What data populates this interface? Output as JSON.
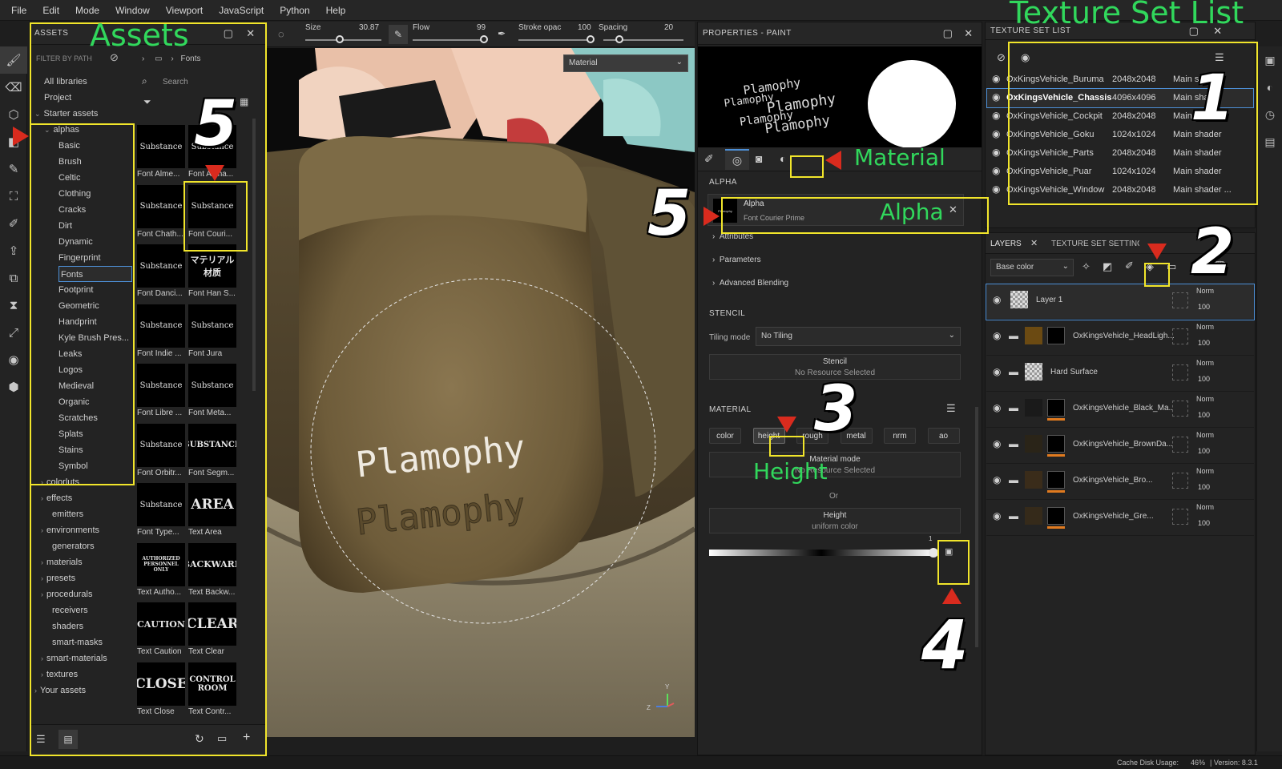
{
  "menu": [
    "File",
    "Edit",
    "Mode",
    "Window",
    "Viewport",
    "JavaScript",
    "Python",
    "Help"
  ],
  "assets": {
    "title": "ASSETS",
    "filter_placeholder": "FILTER BY PATH",
    "breadcrumb": "Fonts",
    "search_placeholder": "Search",
    "tree": {
      "all_libraries": "All libraries",
      "project": "Project",
      "starter_assets": "Starter assets",
      "alphas": "alphas",
      "alpha_children": [
        "Basic",
        "Brush",
        "Celtic",
        "Clothing",
        "Cracks",
        "Dirt",
        "Dynamic",
        "Fingerprint",
        "Fonts",
        "Footprint",
        "Geometric",
        "Handprint",
        "Kyle Brush Pres...",
        "Leaks",
        "Logos",
        "Medieval",
        "Organic",
        "Scratches",
        "Splats",
        "Stains",
        "Symbol"
      ],
      "others": [
        {
          "label": "colorluts",
          "arrow": true
        },
        {
          "label": "effects",
          "arrow": true
        },
        {
          "label": "emitters",
          "arrow": false
        },
        {
          "label": "environments",
          "arrow": true
        },
        {
          "label": "generators",
          "arrow": false
        },
        {
          "label": "materials",
          "arrow": true
        },
        {
          "label": "presets",
          "arrow": true
        },
        {
          "label": "procedurals",
          "arrow": true
        },
        {
          "label": "receivers",
          "arrow": false
        },
        {
          "label": "shaders",
          "arrow": false
        },
        {
          "label": "smart-masks",
          "arrow": false
        },
        {
          "label": "smart-materials",
          "arrow": true
        },
        {
          "label": "textures",
          "arrow": true
        }
      ],
      "your_assets": "Your assets"
    },
    "thumbs": [
      {
        "img": "Substance",
        "label": "Font Alme..."
      },
      {
        "img": "Substance",
        "label": "Font Alpha..."
      },
      {
        "img": "Substance",
        "label": "Font Chath..."
      },
      {
        "img": "Substance",
        "label": "Font Couri..."
      },
      {
        "img": "Substance",
        "label": "Font Danci..."
      },
      {
        "img": "マテリアル 材质",
        "label": "Font Han S..."
      },
      {
        "img": "Substance",
        "label": "Font Indie ..."
      },
      {
        "img": "Substance",
        "label": "Font Jura"
      },
      {
        "img": "Substance",
        "label": "Font Libre ..."
      },
      {
        "img": "Substance",
        "label": "Font Meta..."
      },
      {
        "img": "Substance",
        "label": "Font Orbitr..."
      },
      {
        "img": "SUBSTANCE",
        "label": "Font Segm..."
      },
      {
        "img": "Substance",
        "label": "Font Type..."
      },
      {
        "img": "AREA",
        "label": "Text Area"
      },
      {
        "img": "AUTHORIZED PERSONNEL ONLY",
        "label": "Text Autho..."
      },
      {
        "img": "BACKWARD",
        "label": "Text Backw..."
      },
      {
        "img": "CAUTION",
        "label": "Text Caution"
      },
      {
        "img": "CLEAR",
        "label": "Text Clear"
      },
      {
        "img": "CLOSE",
        "label": "Text Close"
      },
      {
        "img": "CONTROL ROOM",
        "label": "Text Contr..."
      }
    ]
  },
  "brushbar": {
    "size_label": "Size",
    "size_value": "30.87",
    "flow_label": "Flow",
    "flow_value": "99",
    "stroke_label": "Stroke opac",
    "stroke_value": "100",
    "spacing_label": "Spacing",
    "spacing_value": "20",
    "size_fraction": 0.45,
    "flow_fraction": 0.99,
    "stroke_fraction": 1.0,
    "spacing_fraction": 0.2
  },
  "viewport": {
    "material_dropdown": "Material",
    "decal_text": "Plamophy",
    "axis_y": "Y",
    "axis_z": "Z"
  },
  "properties": {
    "title": "PROPERTIES - PAINT",
    "alpha_section": "ALPHA",
    "alpha_name": "Alpha",
    "alpha_sub": "Font Courier Prime",
    "alpha_thumb_text": "Plamophy",
    "attributes": "Attributes",
    "parameters": "Parameters",
    "advanced_blending": "Advanced Blending",
    "stencil_section": "STENCIL",
    "tiling_mode_label": "Tiling mode",
    "tiling_mode_value": "No Tiling",
    "stencil_title": "Stencil",
    "stencil_sub": "No Resource Selected",
    "material_section": "MATERIAL",
    "channels": [
      "color",
      "height",
      "rough",
      "metal",
      "nrm",
      "ao"
    ],
    "material_mode_title": "Material mode",
    "material_mode_sub": "No Resource Selected",
    "or_label": "Or",
    "height_title": "Height",
    "height_sub": "uniform color",
    "height_value": "1"
  },
  "texture_set_list": {
    "title": "TEXTURE SET LIST",
    "rows": [
      {
        "name": "OxKingsVehicle_Buruma",
        "res": "2048x2048",
        "shader": "Main shader"
      },
      {
        "name": "OxKingsVehicle_Chassis",
        "res": "4096x4096",
        "shader": "Main shader"
      },
      {
        "name": "OxKingsVehicle_Cockpit",
        "res": "2048x2048",
        "shader": "Main shader"
      },
      {
        "name": "OxKingsVehicle_Goku",
        "res": "1024x1024",
        "shader": "Main shader"
      },
      {
        "name": "OxKingsVehicle_Parts",
        "res": "2048x2048",
        "shader": "Main shader"
      },
      {
        "name": "OxKingsVehicle_Puar",
        "res": "1024x1024",
        "shader": "Main shader"
      },
      {
        "name": "OxKingsVehicle_Window",
        "res": "2048x2048",
        "shader": "Main shader ..."
      }
    ]
  },
  "layers": {
    "tab_layers": "LAYERS",
    "tab_texture_set": "TEXTURE SET SETTINGS",
    "channel_dropdown": "Base color",
    "rows": [
      {
        "name": "Layer 1",
        "blend": "Norm",
        "opacity": "100"
      },
      {
        "name": "OxKingsVehicle_HeadLigh...",
        "blend": "Norm",
        "opacity": "100"
      },
      {
        "name": "Hard Surface",
        "blend": "Norm",
        "opacity": "100"
      },
      {
        "name": "OxKingsVehicle_Black_Ma...",
        "blend": "Norm",
        "opacity": "100"
      },
      {
        "name": "OxKingsVehicle_BrownDa...",
        "blend": "Norm",
        "opacity": "100"
      },
      {
        "name": "OxKingsVehicle_Bro...",
        "blend": "Norm",
        "opacity": "100"
      },
      {
        "name": "OxKingsVehicle_Gre...",
        "blend": "Norm",
        "opacity": "100"
      }
    ]
  },
  "status": {
    "cache": "Cache Disk Usage:",
    "cache_value": "46%",
    "version": "| Version: 8.3.1"
  },
  "annotations": {
    "assets": "Assets",
    "texture_set_list": "Texture Set List",
    "material": "Material",
    "alpha": "Alpha",
    "height": "Height",
    "n1": "1",
    "n2": "2",
    "n3": "3",
    "n4": "4",
    "n5a": "5",
    "n5b": "5"
  },
  "colors": {
    "annotation_yellow": "#f1e52b",
    "annotation_green": "#31d85c",
    "arrow_red": "#d92b1e",
    "panel_bg": "#232323"
  }
}
